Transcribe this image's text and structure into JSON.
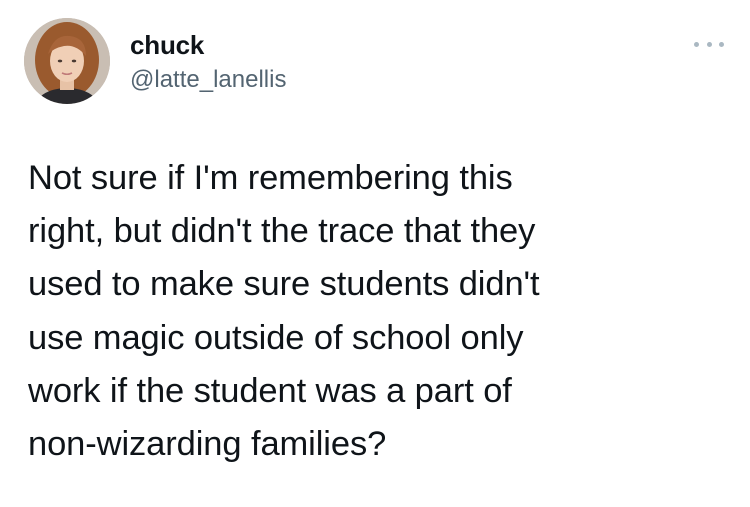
{
  "tweet": {
    "author": {
      "display_name": "chuck",
      "handle": "@latte_lanellis"
    },
    "text": "Not sure if I'm remembering this\nright, but didn't the trace that they\nused to make sure students didn't\nuse magic outside of school only\nwork if the student was a part of\nnon-wizarding families?",
    "more_icon": "more-horizontal-icon"
  }
}
